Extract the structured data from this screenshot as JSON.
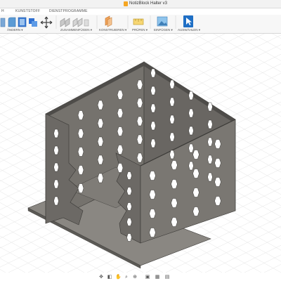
{
  "window": {
    "title": "NotizBlock Halter v3",
    "file_icon": "fusion-file-icon"
  },
  "tabs": [
    {
      "label": "H"
    },
    {
      "label": "KUNSTSTOFF"
    },
    {
      "label": "DIENSTPROGRAMME"
    }
  ],
  "toolbar": {
    "groups": [
      {
        "label": "ÄNDERN ▾"
      },
      {
        "label": "ZUSAMMENFÜGEN ▾"
      },
      {
        "label": "KONSTRUIEREN ▾"
      },
      {
        "label": "PRÜFEN ▾"
      },
      {
        "label": "EINFÜGEN ▾"
      },
      {
        "label": "AUSWÄHLEN ▾"
      }
    ],
    "icons": [
      "press-pull-icon",
      "fillet-icon",
      "shell-icon",
      "move-icon",
      "joint-icon",
      "as-built-joint-icon",
      "offset-plane-icon",
      "measure-icon",
      "insert-image-icon",
      "select-icon"
    ]
  },
  "model": {
    "name": "notepad holder",
    "color": "#6e6b66"
  },
  "navbar": {
    "icons": [
      "orbit-icon",
      "look-at-icon",
      "pan-icon",
      "zoom-icon",
      "fit-icon",
      "display-settings-icon",
      "grid-icon",
      "viewports-icon"
    ]
  }
}
